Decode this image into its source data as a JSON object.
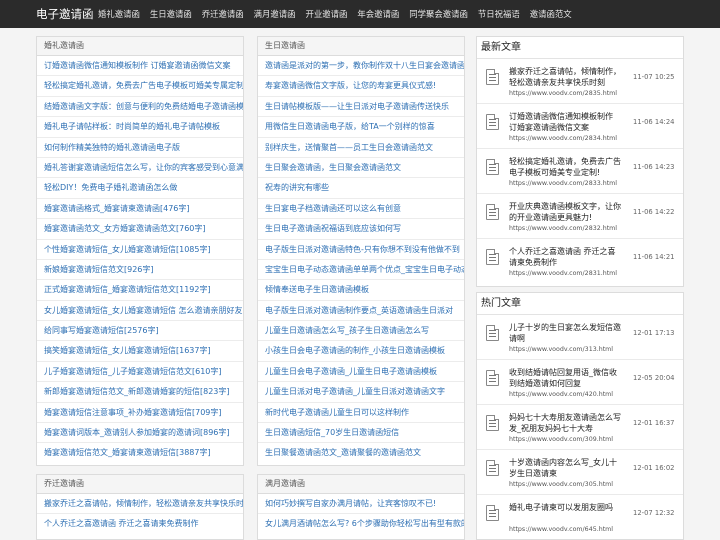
{
  "nav": {
    "brand": "电子邀请函",
    "links": [
      "婚礼邀请函",
      "生日邀请函",
      "乔迁邀请函",
      "满月邀请函",
      "开业邀请函",
      "年会邀请函",
      "同学聚会邀请函",
      "节日祝福语",
      "邀请函范文"
    ]
  },
  "panels": [
    {
      "title": "婚礼邀请函",
      "items": [
        "订婚邀请函微信通知模板制作 订婚宴邀请函微信文案",
        "轻松搞定婚礼邀请，免费去广告电子模板可婚美专属定制",
        "结婚邀请函文字版：创意与便利的免费结婚电子邀请函模板",
        "婚礼电子请帖样板：时尚简单的婚礼电子请帖模板",
        "如何制作精美独特的婚礼邀请函电子版",
        "婚礼答谢宴邀请函短信怎么写，让你的宾客感受到心意满满",
        "轻松DIY！免费电子婚礼邀请函怎么做",
        "婚宴邀请函格式_婚宴请柬邀请函[476字]",
        "婚宴邀请函范文_女方婚宴邀请函范文[760字]",
        "个性婚宴邀请短信_女儿婚宴邀请短信[1085字]",
        "新娘婚宴邀请短信范文[926字]",
        "正式婚宴邀请短信_婚宴邀请短信范文[1192字]",
        "女儿婚宴邀请短信_女儿婚宴邀请短信 怎么邀请亲朋好友[1240字]",
        "给同事写婚宴邀请短信[2576字]",
        "搞笑婚宴邀请短信_女儿婚宴邀请短信[1637字]",
        "儿子婚宴邀请短信_儿子婚宴邀请短信范文[610字]",
        "新郎婚宴邀请短信范文_新郎邀请婚宴的短信[823字]",
        "婚宴邀请短信注意事项_补办婚宴邀请短信[709字]",
        "婚宴邀请词版本_邀请别人参加婚宴的邀请词[896字]",
        "婚宴邀请短信范文_婚宴请柬邀请短信[3887字]"
      ]
    },
    {
      "title": "生日邀请函",
      "items": [
        "邀请函是派对的第一步，教你制作双十八生日宴会邀请函",
        "寿宴邀请函微信文字版，让您的寿宴更具仪式感!",
        "生日请帖模板版——让生日派对电子邀请函传送快乐",
        "用微信生日邀请函电子版，给TA一个别样的惊喜",
        "别样庆生，送情聚首——员工生日会邀请函范文",
        "生日聚会邀请函，生日聚会邀请函范文",
        "祝寿的讲究有哪些",
        "生日宴电子档邀请函还可以这么有创意",
        "生日电子邀请函祝福语到底应该如何写",
        "电子版生日派对邀请函特色-只有你想不到没有他做不到",
        "宝宝生日电子动态邀请函单单两个优点_宝宝生日电子动态邀请函",
        "倾情奉送电子生日邀请函模板",
        "电子版生日派对邀请函制作要点_英语邀请函生日派对",
        "儿童生日邀请函怎么写_孩子生日邀请函怎么写",
        "小孩生日会电子邀请函的制作_小孩生日邀请函模板",
        "儿童生日会电子邀请函_儿童生日电子邀请函模板",
        "儿童生日派对电子邀请函_儿童生日派对邀请函文字",
        "新时代电子邀请函儿童生日可以这样制作",
        "生日邀请函短信_70岁生日邀请函短信",
        "生日聚餐邀请函范文_邀请聚餐的邀请函范文"
      ]
    },
    {
      "title": "乔迁邀请函",
      "items": [
        "搬家乔迁之喜请帖，倾情制作，轻松邀请亲友共享快乐时刻",
        "个人乔迁之喜邀请函 乔迁之喜请柬免费制作"
      ]
    },
    {
      "title": "满月邀请函",
      "items": [
        "如何巧妙撰写自家办满月请帖，让宾客惊叹不已!",
        "女儿满月酒请帖怎么写? 6个步骤助你轻松写出有型有款的满月酒请帖"
      ]
    }
  ],
  "latest": {
    "title": "最新文章",
    "items": [
      {
        "title": "搬家乔迁之喜请帖，倾情制作，轻松邀请亲友共享快乐时刻",
        "url": "https://www.voodv.com/2835.html",
        "time": "11-07 10:25"
      },
      {
        "title": "订婚邀请函微信通知模板制作 订婚宴邀请函微信文案",
        "url": "https://www.voodv.com/2834.html",
        "time": "11-06 14:24"
      },
      {
        "title": "轻松搞定婚礼邀请，免费去广告电子模板可婚美专业定制!",
        "url": "https://www.voodv.com/2833.html",
        "time": "11-06 14:23"
      },
      {
        "title": "开业庆典邀请函模板文字，让你的开业邀请函更具魅力!",
        "url": "https://www.voodv.com/2832.html",
        "time": "11-06 14:22"
      },
      {
        "title": "个人乔迁之喜邀请函 乔迁之喜请柬免费制作",
        "url": "https://www.voodv.com/2831.html",
        "time": "11-06 14:21"
      }
    ]
  },
  "hot": {
    "title": "热门文章",
    "items": [
      {
        "title": "儿子十岁的生日宴怎么发短信邀请啊",
        "url": "https://www.voodv.com/313.html",
        "time": "12-01 17:13"
      },
      {
        "title": "收到结婚请帖回复用语_微信收到结婚邀请如何回复",
        "url": "https://www.voodv.com/420.html",
        "time": "12-05 20:04"
      },
      {
        "title": "妈妈七十大寿朋友邀请函怎么写发_祝朋友妈妈七十大寿",
        "url": "https://www.voodv.com/309.html",
        "time": "12-01 16:37"
      },
      {
        "title": "十岁邀请函内容怎么写_女儿十岁生日邀请柬",
        "url": "https://www.voodv.com/305.html",
        "time": "12-01 16:02"
      },
      {
        "title": "婚礼电子请柬可以发朋友圈吗",
        "url": "https://www.voodv.com/645.html",
        "time": "12-07 12:32"
      }
    ]
  }
}
